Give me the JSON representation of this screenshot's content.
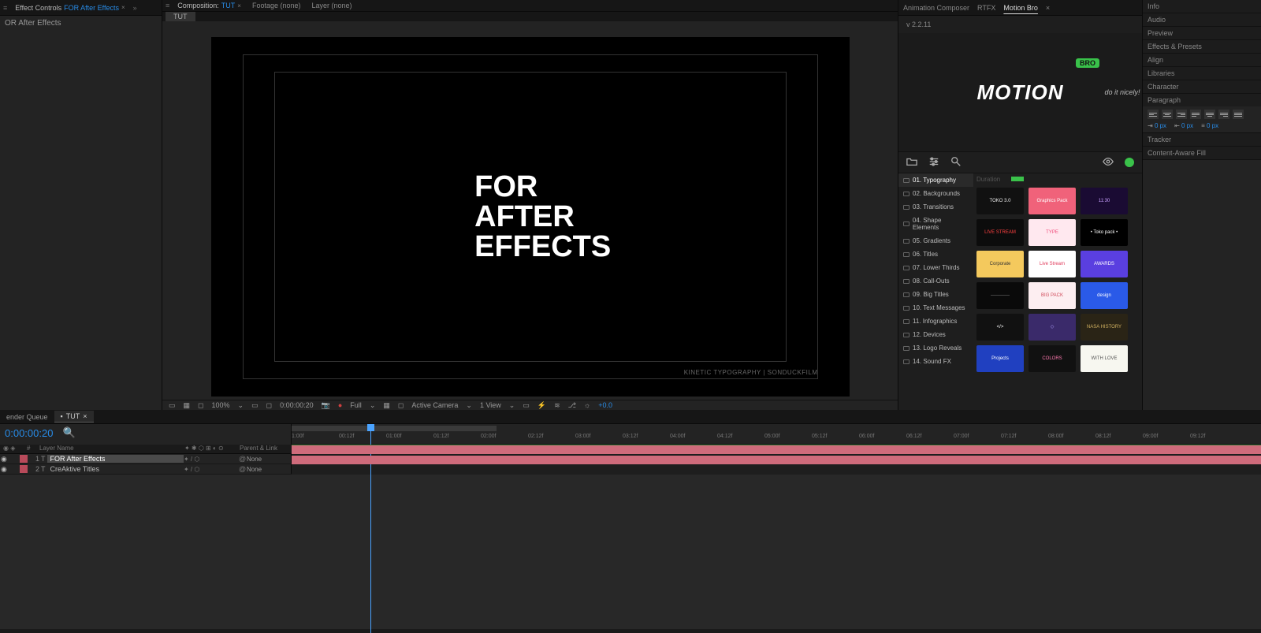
{
  "projectPanel": {
    "tabHint": "≡",
    "effectControlsLabel": "Effect Controls",
    "effectControlsTarget": "FOR After Effects",
    "chev": "»",
    "breadcrumb": "OR After Effects"
  },
  "compPanel": {
    "tabLabel": "Composition:",
    "compName": "TUT",
    "footageTab": "Footage  (none)",
    "layerTab": "Layer  (none)",
    "subTab": "TUT"
  },
  "viewer": {
    "titleLine1": "FOR",
    "titleLine2": "AFTER",
    "titleLine3": "EFFECTS",
    "watermark": "KINETIC TYPOGRAPHY | SONDUCKFILM"
  },
  "viewerFooter": {
    "zoom": "100%",
    "timecode": "0:00:00:20",
    "quality": "Full",
    "camera": "Active Camera",
    "views": "1 View",
    "exposure": "+0.0"
  },
  "motionBro": {
    "tabs": [
      "Animation Composer",
      "RTFX",
      "Motion Bro"
    ],
    "version": "v 2.2.11",
    "logoMain": "MOTION",
    "logoBadge": "BRO",
    "logoSub": "do it nicely!",
    "durationLabel": "Duration",
    "categories": [
      "01. Typography",
      "02. Backgrounds",
      "03. Transitions",
      "04. Shape Elements",
      "05. Gradients",
      "06. Titles",
      "07. Lower Thirds",
      "08. Call-Outs",
      "09. Big Titles",
      "10. Text Messages",
      "11. Infographics",
      "12. Devices",
      "13. Logo Reveals",
      "14. Sound FX"
    ],
    "thumbs": [
      {
        "label": "TOKO 3.0",
        "bg": "#111",
        "fg": "#eee"
      },
      {
        "label": "Graphics Pack",
        "bg": "#f0627a",
        "fg": "#fff"
      },
      {
        "label": "11:30",
        "bg": "#1a0b33",
        "fg": "#c9a0ff"
      },
      {
        "label": "LIVE STREAM",
        "bg": "#0c0c0c",
        "fg": "#ff4040"
      },
      {
        "label": "TYPE",
        "bg": "#ffe8ef",
        "fg": "#f04a7a"
      },
      {
        "label": "• Toko pack •",
        "bg": "#000",
        "fg": "#fff"
      },
      {
        "label": "Corporate",
        "bg": "#f4c95d",
        "fg": "#333"
      },
      {
        "label": "Live Stream",
        "bg": "#fff",
        "fg": "#e03a5a"
      },
      {
        "label": "AWARDS",
        "bg": "#5a3fe0",
        "fg": "#fff"
      },
      {
        "label": "————",
        "bg": "#0a0a0a",
        "fg": "#888"
      },
      {
        "label": "BIG PACK",
        "bg": "#fdeef1",
        "fg": "#d04a5a"
      },
      {
        "label": "design",
        "bg": "#2a5ae8",
        "fg": "#fff"
      },
      {
        "label": "</>",
        "bg": "#111",
        "fg": "#fff"
      },
      {
        "label": "◇",
        "bg": "#3a2a6a",
        "fg": "#b0a0ff"
      },
      {
        "label": "NASA HISTORY",
        "bg": "#2a2416",
        "fg": "#d0b060"
      },
      {
        "label": "Projects",
        "bg": "#2040c0",
        "fg": "#fff"
      },
      {
        "label": "COLORS",
        "bg": "#111",
        "fg": "#ff7ab0"
      },
      {
        "label": "WITH LOVE",
        "bg": "#f7f7f0",
        "fg": "#555"
      }
    ]
  },
  "rightPanels": {
    "items": [
      "Info",
      "Audio",
      "Preview",
      "Effects & Presets",
      "Align",
      "Libraries",
      "Character"
    ],
    "paragraph": "Paragraph",
    "px1": "0 px",
    "px2": "0 px",
    "px3": "0 px",
    "tracker": "Tracker",
    "contentAware": "Content-Aware Fill"
  },
  "timeline": {
    "renderTab": "ender Queue",
    "compTab": "TUT",
    "timecode": "0:00:00:20",
    "colLayerName": "Layer Name",
    "colParent": "Parent & Link",
    "none": "None",
    "layers": [
      {
        "idx": "1",
        "name": "FOR After Effects",
        "selected": true
      },
      {
        "idx": "2",
        "name": "CreAktive Titles",
        "selected": false
      }
    ],
    "ticks": [
      "1:00f",
      "00:12f",
      "01:00f",
      "01:12f",
      "02:00f",
      "02:12f",
      "03:00f",
      "03:12f",
      "04:00f",
      "04:12f",
      "05:00f",
      "05:12f",
      "06:00f",
      "06:12f",
      "07:00f",
      "07:12f",
      "08:00f",
      "08:12f",
      "09:00f",
      "09:12f"
    ]
  }
}
